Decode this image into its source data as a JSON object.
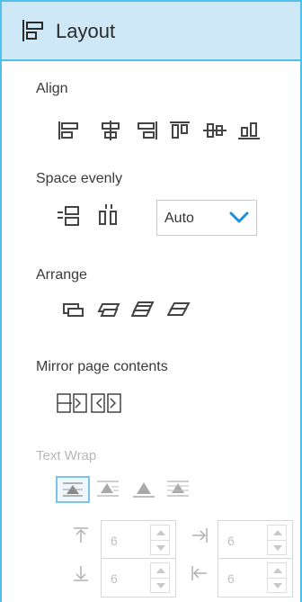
{
  "panel": {
    "title": "Layout",
    "title_icon": "layout-icon",
    "accent_color": "#4fc0e8",
    "header_bg": "#cfe8f7"
  },
  "align": {
    "label": "Align",
    "buttons": [
      {
        "icon": "align-left-icon"
      },
      {
        "icon": "align-center-icon"
      },
      {
        "icon": "align-right-icon"
      },
      {
        "icon": "align-top-icon"
      },
      {
        "icon": "align-middle-icon"
      },
      {
        "icon": "align-bottom-icon"
      }
    ]
  },
  "space_evenly": {
    "label": "Space evenly",
    "buttons": [
      {
        "icon": "distribute-vertical-icon"
      },
      {
        "icon": "distribute-horizontal-icon"
      }
    ],
    "select_value": "Auto"
  },
  "arrange": {
    "label": "Arrange",
    "buttons": [
      {
        "icon": "bring-to-front-icon"
      },
      {
        "icon": "bring-forward-icon"
      },
      {
        "icon": "send-backward-icon"
      },
      {
        "icon": "send-to-back-icon"
      }
    ]
  },
  "mirror": {
    "label": "Mirror page contents",
    "buttons": [
      {
        "icon": "mirror-horizontal-icon"
      },
      {
        "icon": "mirror-vertical-icon"
      }
    ]
  },
  "text_wrap": {
    "label": "Text Wrap",
    "disabled": true,
    "buttons": [
      {
        "icon": "wrap-around-icon",
        "selected": true
      },
      {
        "icon": "wrap-top-bottom-icon"
      },
      {
        "icon": "wrap-behind-icon"
      },
      {
        "icon": "wrap-in-front-icon"
      }
    ],
    "offsets": {
      "top": "6",
      "right": "6",
      "bottom": "6",
      "left": "6"
    }
  }
}
